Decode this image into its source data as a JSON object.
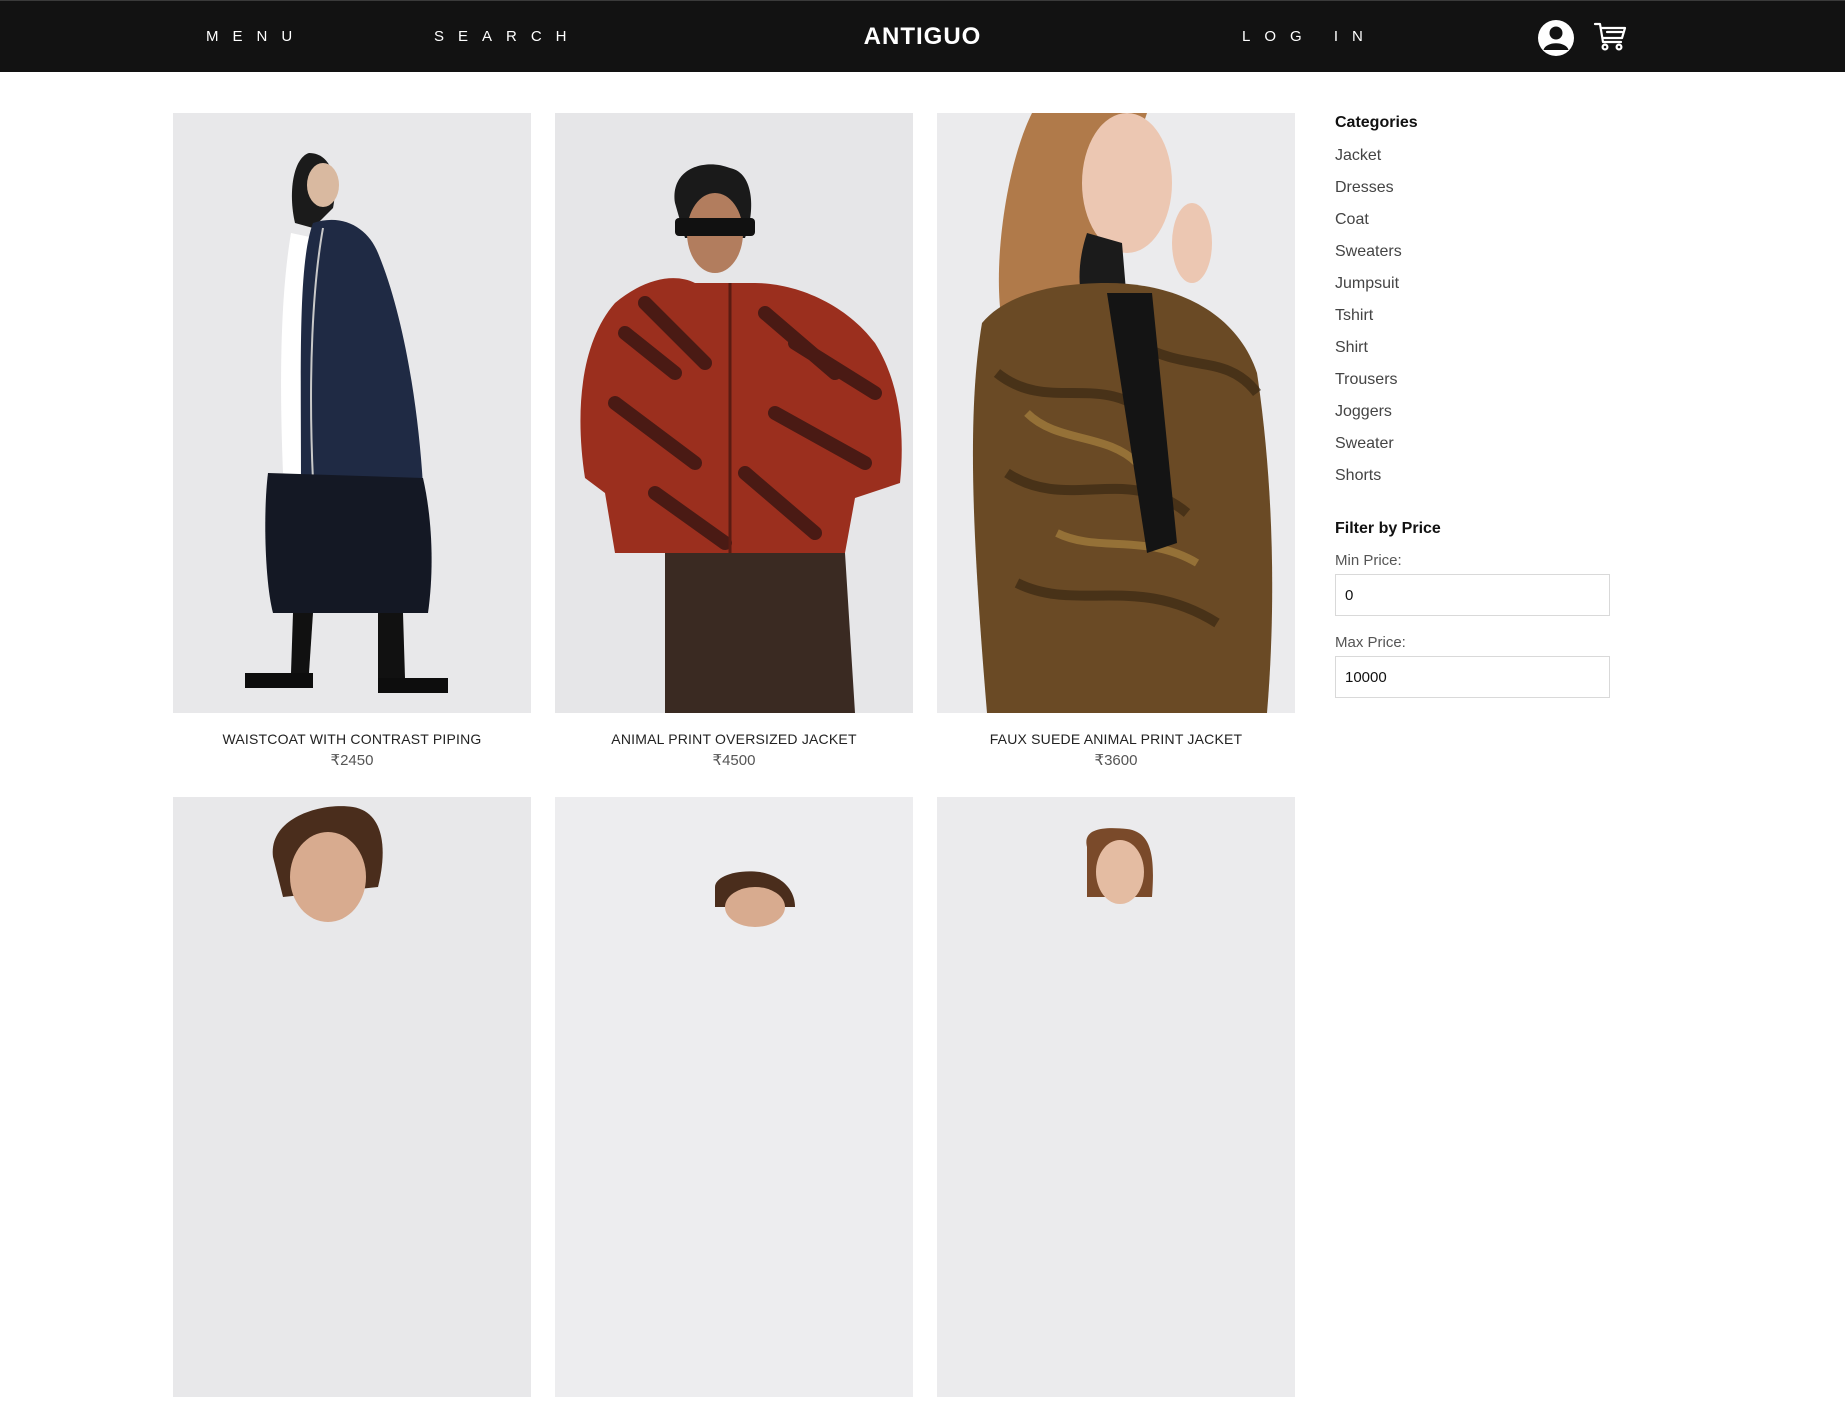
{
  "header": {
    "menu_label": "MENU",
    "search_label": "SEARCH",
    "brand": "ANTIGUO",
    "login_label": "LOG IN",
    "account_icon": "user-avatar-icon",
    "cart_icon": "shopping-cart-icon"
  },
  "products": [
    {
      "name": "WAISTCOAT WITH CONTRAST PIPING",
      "price": "₹2450"
    },
    {
      "name": "ANIMAL PRINT OVERSIZED JACKET",
      "price": "₹4500"
    },
    {
      "name": "FAUX SUEDE ANIMAL PRINT JACKET",
      "price": "₹3600"
    },
    {
      "name": "",
      "price": ""
    },
    {
      "name": "",
      "price": ""
    },
    {
      "name": "",
      "price": ""
    }
  ],
  "sidebar": {
    "categories_title": "Categories",
    "categories": [
      "Jacket",
      "Dresses",
      "Coat",
      "Sweaters",
      "Jumpsuit",
      "Tshirt",
      "Shirt",
      "Trousers",
      "Joggers",
      "Sweater",
      "Shorts"
    ],
    "filter_title": "Filter by Price",
    "min_label": "Min Price:",
    "min_value": "0",
    "max_label": "Max Price:",
    "max_value": "10000"
  },
  "colors": {
    "header_bg": "#121212",
    "header_text": "#ffffff",
    "photo_bg": "#e8e8ea"
  }
}
